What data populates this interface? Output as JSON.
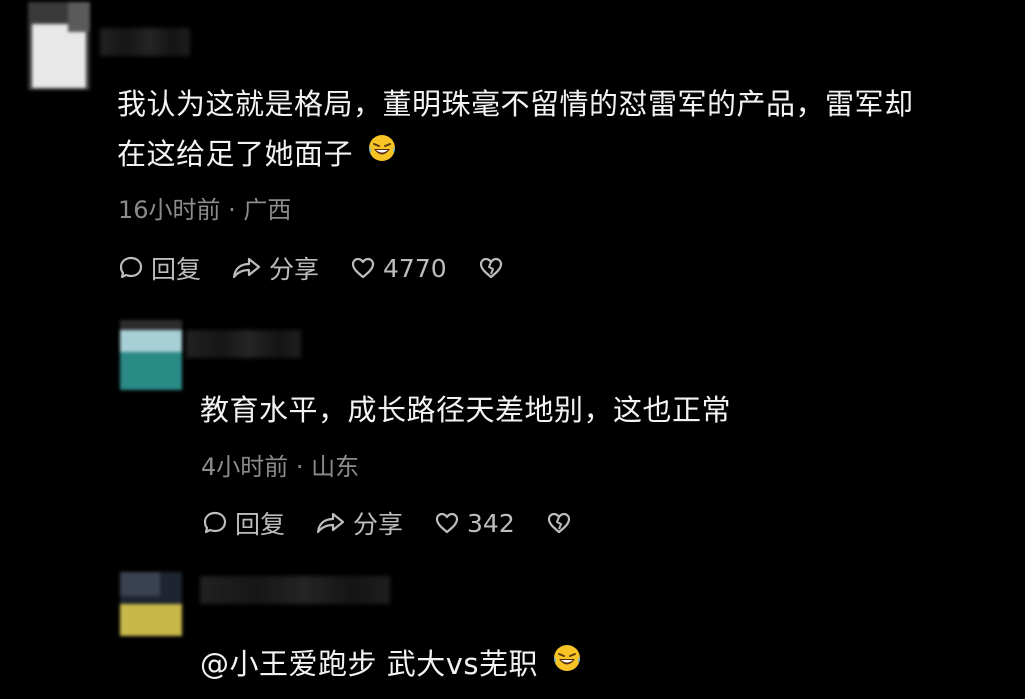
{
  "comments": [
    {
      "text_line1": "我认为这就是格局，董明珠毫不留情的怼雷军的产品，雷军却",
      "text_line2": "在这给足了她面子",
      "emoji": "laughing-tears",
      "meta": "16小时前 · 广西",
      "reply_label": "回复",
      "share_label": "分享",
      "likes": "4770"
    },
    {
      "text_line1": "教育水平，成长路径天差地别，这也正常",
      "meta": "4小时前 · 山东",
      "reply_label": "回复",
      "share_label": "分享",
      "likes": "342"
    },
    {
      "text_line1": "@小王爱跑步 武大vs芜职",
      "emoji": "laughing-tears"
    }
  ],
  "icons": {
    "reply": "comment-bubble-icon",
    "share": "share-arrow-icon",
    "like": "heart-icon",
    "dislike": "broken-heart-icon"
  },
  "colors": {
    "background": "#000000",
    "text": "#f3f3f3",
    "meta": "#8c8c8c",
    "action": "#bdbdbd"
  }
}
